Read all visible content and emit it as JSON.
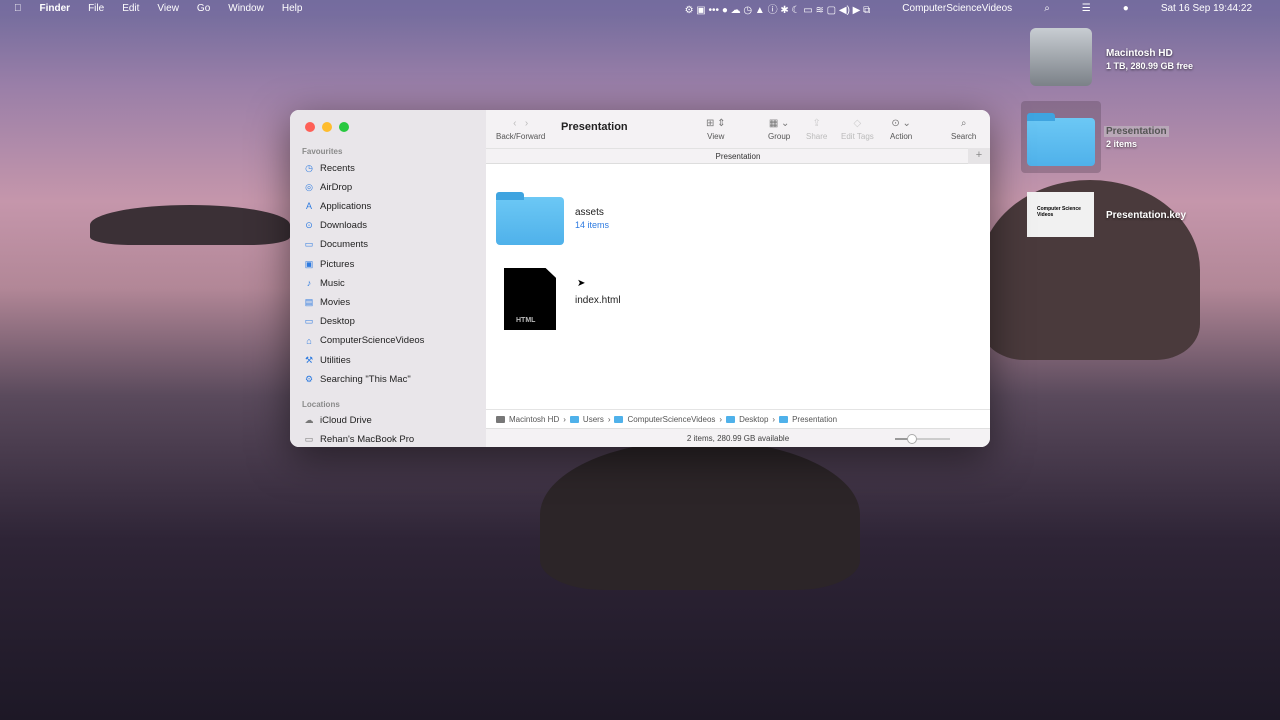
{
  "menubar": {
    "app": "Finder",
    "items": [
      "File",
      "Edit",
      "View",
      "Go",
      "Window",
      "Help"
    ],
    "user": "ComputerScienceVideos",
    "datetime": "Sat 16 Sep  19:44:22"
  },
  "desktop": {
    "items": [
      {
        "name": "Macintosh HD",
        "sub": "1 TB, 280.99 GB free"
      },
      {
        "name": "Presentation",
        "sub": "2 items"
      },
      {
        "name": "Presentation.key",
        "thumb_text": "Computer Science Videos"
      }
    ]
  },
  "window": {
    "title": "Presentation",
    "tab": "Presentation",
    "toolbar": {
      "back_forward": "Back/Forward",
      "view": "View",
      "group": "Group",
      "share": "Share",
      "edit_tags": "Edit Tags",
      "action": "Action",
      "search": "Search"
    },
    "sidebar": {
      "favourites_label": "Favourites",
      "favourites": [
        "Recents",
        "AirDrop",
        "Applications",
        "Downloads",
        "Documents",
        "Pictures",
        "Music",
        "Movies",
        "Desktop",
        "ComputerScienceVideos",
        "Utilities",
        "Searching \"This Mac\""
      ],
      "locations_label": "Locations",
      "locations": [
        "iCloud Drive",
        "Rehan's MacBook Pro"
      ]
    },
    "files": [
      {
        "name": "assets",
        "sub": "14 items"
      },
      {
        "name": "index.html",
        "badge": "HTML"
      }
    ],
    "path": [
      "Macintosh HD",
      "Users",
      "ComputerScienceVideos",
      "Desktop",
      "Presentation"
    ],
    "status": "2 items, 280.99 GB available",
    "icon_size_slider": 0.3
  }
}
